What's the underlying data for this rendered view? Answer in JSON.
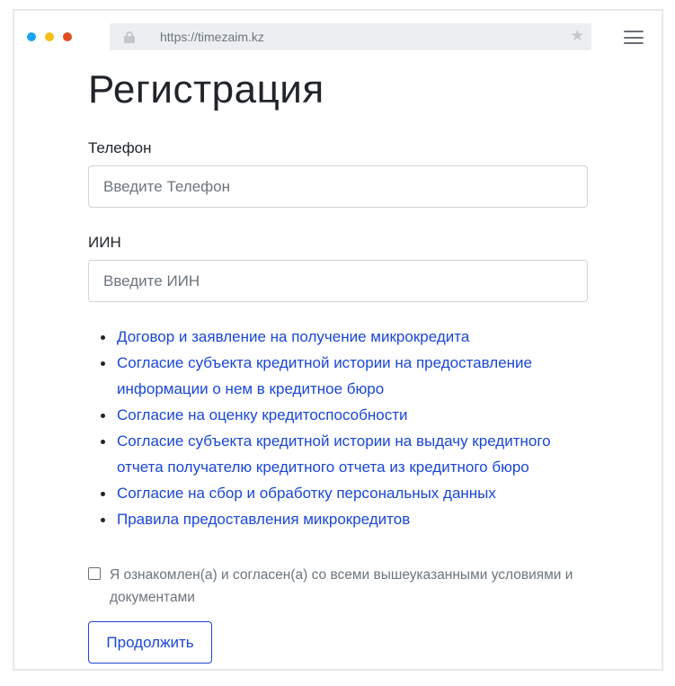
{
  "browser": {
    "url": "https://timezaim.kz",
    "dot_colors": [
      "#1aa3ef",
      "#f5bf15",
      "#e14d20"
    ],
    "icons": [
      "lock-icon",
      "star-icon",
      "hamburger-menu-icon"
    ]
  },
  "page": {
    "title": "Регистрация",
    "phone": {
      "label": "Телефон",
      "value": "",
      "placeholder": "Введите Телефон"
    },
    "iin": {
      "label": "ИИН",
      "value": "",
      "placeholder": "Введите ИИН"
    },
    "documents": [
      "Договор и заявление на получение микрокредита",
      "Согласие субъекта кредитной истории на предоставление информации о нем в кредитное бюро",
      "Согласие на оценку кредитоспособности",
      "Согласие субъекта кредитной истории на выдачу кредитного отчета получателю кредитного отчета из кредитного бюро",
      "Согласие на сбор и обработку персональных данных",
      "Правила предоставления микрокредитов"
    ],
    "consent": {
      "checked": false,
      "text": "Я ознакомлен(а) и согласен(а) со всеми вышеуказанными условиями и документами"
    },
    "continue_label": "Продолжить"
  },
  "colors": {
    "link": "#1a47d6",
    "text": "#212529",
    "muted": "#6c757d",
    "border": "#ced4da"
  }
}
